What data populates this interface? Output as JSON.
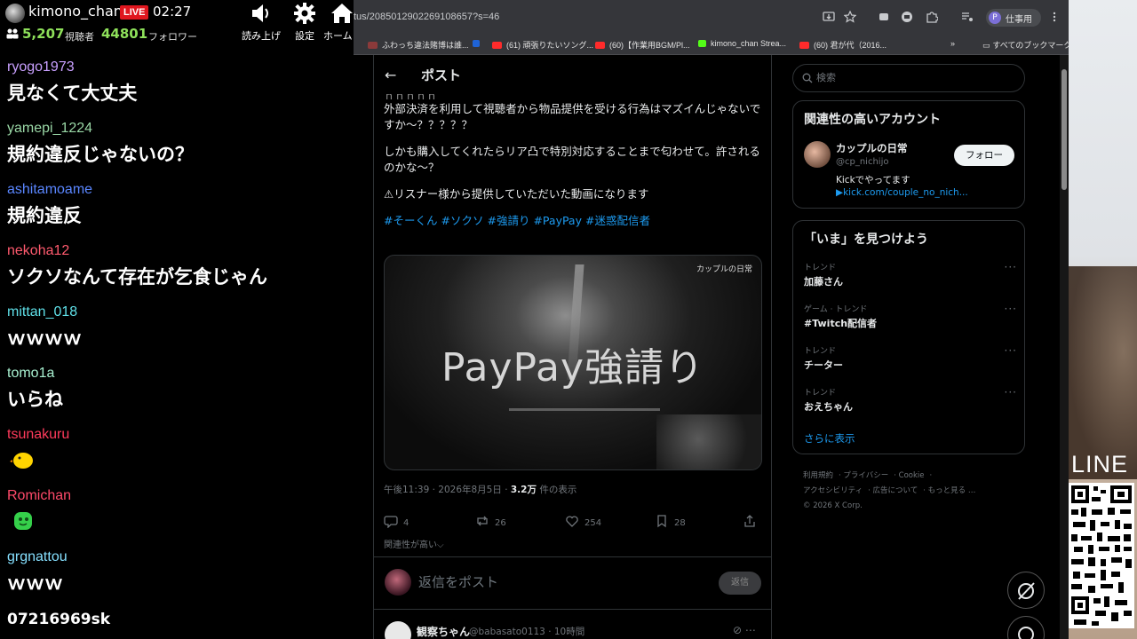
{
  "stream": {
    "streamer_name": "kimono_chan",
    "live_label": "LIVE",
    "elapsed": "02:27",
    "viewer_count": "5,207",
    "viewer_label": "視聴者",
    "follower_count": "44801",
    "follower_label": "フォロワー",
    "tools": [
      {
        "label": "読み上げ",
        "icon": "speaker-icon"
      },
      {
        "label": "設定",
        "icon": "gear-icon"
      },
      {
        "label": "ホーム",
        "icon": "home-icon"
      }
    ]
  },
  "chat": {
    "messages": [
      {
        "user": "ryogo1973",
        "color": "#c9a0ff",
        "text": "見なくて大丈夫"
      },
      {
        "user": "yamepi_1224",
        "color": "#9ad8a6",
        "text": "規約違反じゃないの？"
      },
      {
        "user": "ashitamoame",
        "color": "#5a86ff",
        "text": "規約違反"
      },
      {
        "user": "nekoha12",
        "color": "#ff5a6e",
        "text": "ソクソなんて存在が乞食じゃん"
      },
      {
        "user": "mittan_018",
        "color": "#5fe0e8",
        "text": "ｗｗｗｗ"
      },
      {
        "user": "tomo1a",
        "color": "#a8f0d0",
        "text": "いらね"
      },
      {
        "user": "tsunakuru",
        "color": "#ff3b5c",
        "emote": "yellow-chick-emote"
      },
      {
        "user": "Romichan",
        "color": "#ff4a6a",
        "emote": "green-blob-emote"
      },
      {
        "user": "grgnattou",
        "color": "#86e0ff",
        "text": "ｗｗｗ"
      },
      {
        "user": "07216969sk",
        "color": "#ffffff",
        "text": ""
      }
    ]
  },
  "browser": {
    "url": "tus/2085012902269108657?s=46",
    "profile_initial": "P",
    "profile_label": "仕事用",
    "bookmarks": [
      {
        "label": "ふわっち違法賭博は誰...",
        "color": "#8b3a3a"
      },
      {
        "label": "",
        "color": "#1f63d6"
      },
      {
        "label": "(61) 頑張りたいソング...",
        "color": "#ff2b2b"
      },
      {
        "label": "(60)【作業用BGM/Pl...",
        "color": "#ff2b2b"
      },
      {
        "label": "kimono_chan Strea...",
        "color": "#53fc18"
      },
      {
        "label": "(60) 君が代（2016...",
        "color": "#ff2b2b"
      }
    ],
    "all_bookmarks": "すべてのブックマーク"
  },
  "post": {
    "header_title": "ポスト",
    "body_cut": "ｎｎｎｎｎ",
    "body": [
      "外部決済を利用して視聴者から物品提供を受ける行為はマズイんじゃないですか～？？？？？",
      "しかも購入してくれたらリア凸で特別対応することまで匂わせて。許されるのかな～？",
      "⚠リスナー様から提供していただいた動画になります"
    ],
    "hashtags": [
      "#そーくん",
      "#ソクソ",
      "#強請り",
      "#PayPay",
      "#迷惑配信者"
    ],
    "media": {
      "source_label": "カップルの日常",
      "caption": "PayPay強請り"
    },
    "meta_time": "午後11:39 · 2026年8月5日 · ",
    "views": "3.2万",
    "views_suffix": " 件の表示",
    "stats": {
      "replies": "4",
      "reposts": "26",
      "likes": "254",
      "bookmarks": "28"
    },
    "relevance": "関連性が高い",
    "reply_placeholder": "返信をポスト",
    "reply_button": "返信",
    "next": {
      "name": "観察ちゃん",
      "handle": "@babasato0113 · 10時間"
    }
  },
  "sidebar": {
    "search_placeholder": "検索",
    "related": {
      "title": "関連性の高いアカウント",
      "name": "カップルの日常",
      "handle": "@cp_nichijo",
      "bio_line1": "Kickでやってます",
      "bio_line2": "▶kick.com/couple_no_nich...",
      "follow_label": "フォロー"
    },
    "trends": {
      "title": "「いま」を見つけよう",
      "items": [
        {
          "category": "トレンド",
          "name": "加藤さん"
        },
        {
          "category": "ゲーム · トレンド",
          "name": "#Twitch配信者"
        },
        {
          "category": "トレンド",
          "name": "チーター"
        },
        {
          "category": "トレンド",
          "name": "おえちゃん"
        }
      ],
      "show_more": "さらに表示"
    },
    "footer": [
      "利用規約",
      "プライバシー",
      "Cookie",
      "アクセシビリティ",
      "広告について",
      "もっと見る …",
      "© 2026 X Corp."
    ]
  },
  "overlay": {
    "line_label": "LINE"
  }
}
